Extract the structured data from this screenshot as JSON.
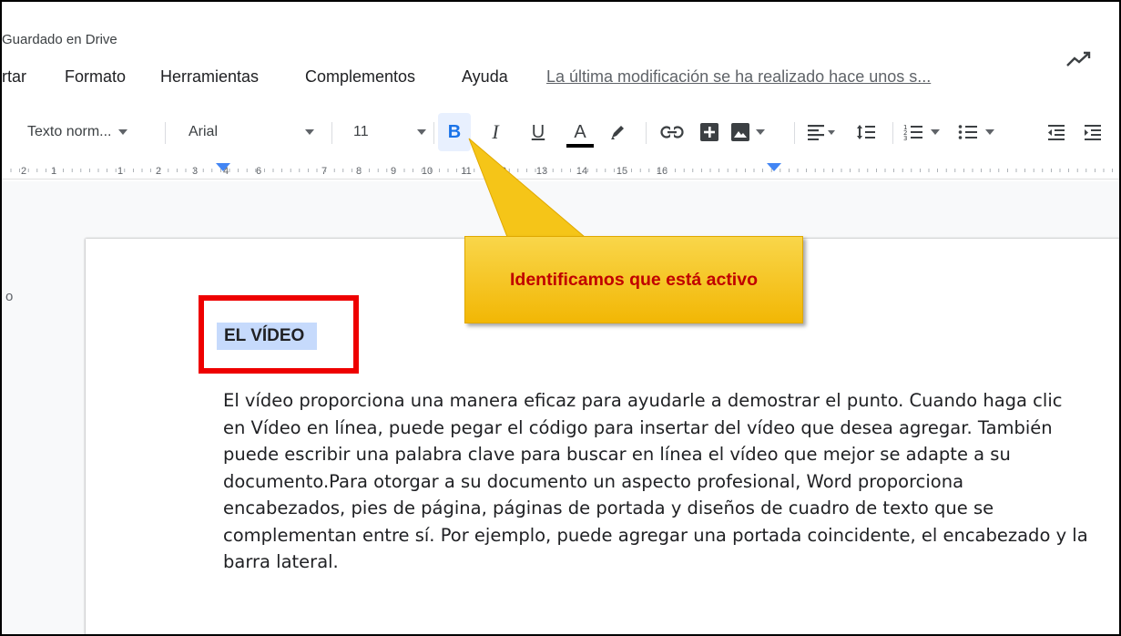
{
  "header": {
    "saved_status": "Guardado en Drive"
  },
  "menu": {
    "items": [
      "Insertar",
      "Formato",
      "Herramientas",
      "Complementos",
      "Ayuda"
    ],
    "last_edit": "La última modificación se ha realizado hace unos s..."
  },
  "toolbar": {
    "style": "Texto norm...",
    "font": "Arial",
    "size": "11",
    "bold": "B",
    "italic": "I",
    "underline": "U",
    "text_color": "A",
    "bold_active": true,
    "icons": [
      "bold-icon",
      "italic-icon",
      "underline-icon",
      "text-color-icon",
      "highlight-icon",
      "link-icon",
      "add-comment-icon",
      "insert-image-icon",
      "align-icon",
      "line-spacing-icon",
      "numbered-list-icon",
      "bulleted-list-icon",
      "decrease-indent-icon",
      "increase-indent-icon"
    ]
  },
  "ruler": {
    "marks": [
      "2",
      "1",
      "1",
      "2",
      "3",
      "4",
      "6",
      "7",
      "8",
      "9",
      "10",
      "11",
      "12",
      "13",
      "14",
      "15",
      "16"
    ]
  },
  "sidebar": {
    "label": "o"
  },
  "document": {
    "heading": "EL VÍDEO",
    "paragraph": "El vídeo proporciona una manera eficaz para ayudarle a demostrar el punto. Cuando haga clic en Vídeo en línea, puede pegar el código para insertar del vídeo que desea agregar. También puede escribir una palabra clave para buscar en línea el vídeo que mejor se adapte a su documento.Para otorgar a su documento un aspecto profesional, Word proporciona encabezados, pies de página, páginas de portada y diseños de cuadro de texto que se complementan entre sí. Por ejemplo, puede agregar una portada coincidente, el encabezado y la barra lateral."
  },
  "callout": {
    "text": "Identificamos que está activo"
  },
  "colors": {
    "accent": "#1a73e8",
    "highlight_red": "#ee0000",
    "callout_fill": "#f5c518",
    "callout_text": "#c00000",
    "selection": "#c6dafc"
  }
}
